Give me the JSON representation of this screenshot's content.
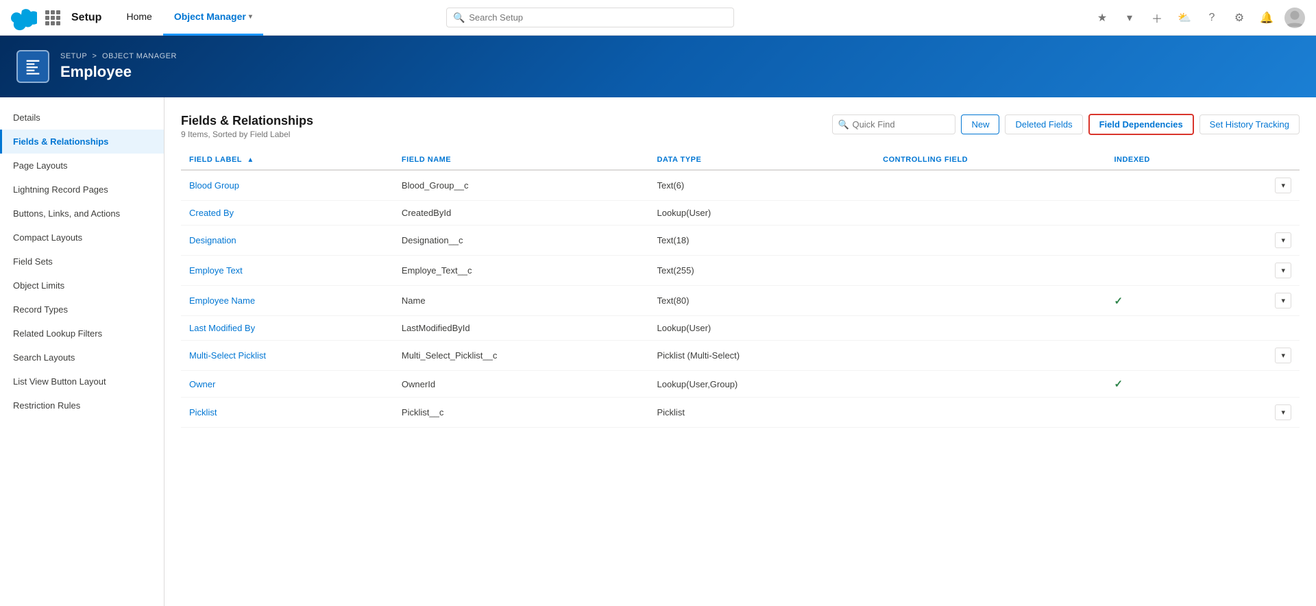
{
  "topNav": {
    "appName": "Setup",
    "tabs": [
      {
        "label": "Home",
        "active": false
      },
      {
        "label": "Object Manager",
        "active": true,
        "hasChevron": true
      }
    ],
    "searchPlaceholder": "Search Setup"
  },
  "pageHeader": {
    "breadcrumb": {
      "setup": "SETUP",
      "separator": ">",
      "objectManager": "OBJECT MANAGER"
    },
    "title": "Employee"
  },
  "sidebar": {
    "items": [
      {
        "label": "Details",
        "active": false
      },
      {
        "label": "Fields & Relationships",
        "active": true
      },
      {
        "label": "Page Layouts",
        "active": false
      },
      {
        "label": "Lightning Record Pages",
        "active": false
      },
      {
        "label": "Buttons, Links, and Actions",
        "active": false
      },
      {
        "label": "Compact Layouts",
        "active": false
      },
      {
        "label": "Field Sets",
        "active": false
      },
      {
        "label": "Object Limits",
        "active": false
      },
      {
        "label": "Record Types",
        "active": false
      },
      {
        "label": "Related Lookup Filters",
        "active": false
      },
      {
        "label": "Search Layouts",
        "active": false
      },
      {
        "label": "List View Button Layout",
        "active": false
      },
      {
        "label": "Restriction Rules",
        "active": false
      }
    ]
  },
  "content": {
    "title": "Fields & Relationships",
    "subtitle": "9 Items, Sorted by Field Label",
    "quickFindPlaceholder": "Quick Find",
    "buttons": {
      "new": "New",
      "deletedFields": "Deleted Fields",
      "fieldDependencies": "Field Dependencies",
      "setHistoryTracking": "Set History Tracking"
    },
    "tableColumns": [
      {
        "label": "FIELD LABEL",
        "sortable": true
      },
      {
        "label": "FIELD NAME"
      },
      {
        "label": "DATA TYPE"
      },
      {
        "label": "CONTROLLING FIELD"
      },
      {
        "label": "INDEXED"
      }
    ],
    "rows": [
      {
        "fieldLabel": "Blood Group",
        "fieldName": "Blood_Group__c",
        "dataType": "Text(6)",
        "controllingField": "",
        "indexed": false,
        "hasAction": true
      },
      {
        "fieldLabel": "Created By",
        "fieldName": "CreatedById",
        "dataType": "Lookup(User)",
        "controllingField": "",
        "indexed": false,
        "hasAction": false
      },
      {
        "fieldLabel": "Designation",
        "fieldName": "Designation__c",
        "dataType": "Text(18)",
        "controllingField": "",
        "indexed": false,
        "hasAction": true
      },
      {
        "fieldLabel": "Employe Text",
        "fieldName": "Employe_Text__c",
        "dataType": "Text(255)",
        "controllingField": "",
        "indexed": false,
        "hasAction": true
      },
      {
        "fieldLabel": "Employee Name",
        "fieldName": "Name",
        "dataType": "Text(80)",
        "controllingField": "",
        "indexed": true,
        "hasAction": true
      },
      {
        "fieldLabel": "Last Modified By",
        "fieldName": "LastModifiedById",
        "dataType": "Lookup(User)",
        "controllingField": "",
        "indexed": false,
        "hasAction": false
      },
      {
        "fieldLabel": "Multi-Select Picklist",
        "fieldName": "Multi_Select_Picklist__c",
        "dataType": "Picklist (Multi-Select)",
        "controllingField": "",
        "indexed": false,
        "hasAction": true
      },
      {
        "fieldLabel": "Owner",
        "fieldName": "OwnerId",
        "dataType": "Lookup(User,Group)",
        "controllingField": "",
        "indexed": true,
        "hasAction": false
      },
      {
        "fieldLabel": "Picklist",
        "fieldName": "Picklist__c",
        "dataType": "Picklist",
        "controllingField": "",
        "indexed": false,
        "hasAction": true
      }
    ]
  }
}
